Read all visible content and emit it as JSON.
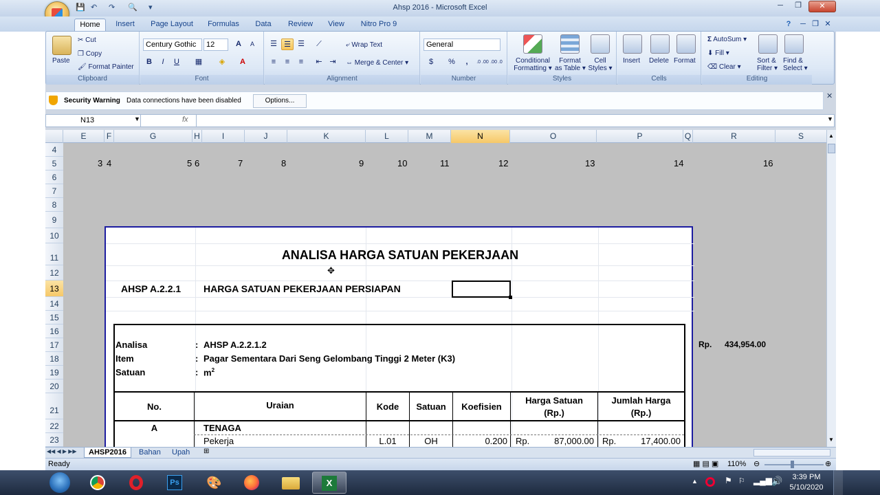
{
  "window": {
    "title": "Ahsp 2016 - Microsoft Excel",
    "minimize": "─",
    "restore": "❐",
    "close": "✕",
    "doc_min": "─",
    "doc_restore": "❐",
    "doc_close": "✕"
  },
  "qat": {
    "save": "💾",
    "undo": "↶",
    "redo": "↷",
    "preview": "🔍",
    "more": "▾"
  },
  "tabs": [
    "Home",
    "Insert",
    "Page Layout",
    "Formulas",
    "Data",
    "Review",
    "View",
    "Nitro Pro 9"
  ],
  "help_icon": "?",
  "ribbon": {
    "clipboard": {
      "label": "Clipboard",
      "paste": "Paste",
      "cut": "Cut",
      "copy": "Copy",
      "format_painter": "Format Painter"
    },
    "font": {
      "label": "Font",
      "name": "Century Gothic",
      "size": "12",
      "bold": "B",
      "italic": "I",
      "underline": "U",
      "grow": "A",
      "shrink": "A"
    },
    "alignment": {
      "label": "Alignment",
      "wrap": "Wrap Text",
      "merge": "Merge & Center"
    },
    "number": {
      "label": "Number",
      "format": "General",
      "currency": "$",
      "percent": "%",
      "comma": ",",
      "inc": ".0 .00",
      "dec": ".00 .0"
    },
    "styles": {
      "label": "Styles",
      "conditional": "Conditional",
      "conditional2": "Formatting",
      "format_table": "Format",
      "format_table2": "as Table",
      "cell_styles": "Cell",
      "cell_styles2": "Styles"
    },
    "cells": {
      "label": "Cells",
      "insert": "Insert",
      "delete": "Delete",
      "format": "Format"
    },
    "editing": {
      "label": "Editing",
      "autosum": "AutoSum",
      "fill": "Fill",
      "clear": "Clear",
      "sort": "Sort &",
      "sort2": "Filter",
      "find": "Find &",
      "find2": "Select"
    }
  },
  "security": {
    "label": "Security Warning",
    "message": "Data connections have been disabled",
    "options": "Options...",
    "close": "✕"
  },
  "formula_bar": {
    "name_box": "N13",
    "fx": "fx",
    "value": ""
  },
  "columns": [
    "E",
    "F",
    "G",
    "H",
    "I",
    "J",
    "K",
    "L",
    "M",
    "N",
    "O",
    "P",
    "Q",
    "R",
    "S"
  ],
  "rows": [
    "4",
    "5",
    "6",
    "7",
    "8",
    "9",
    "10",
    "11",
    "12",
    "13",
    "14",
    "15",
    "16",
    "17",
    "18",
    "19",
    "20",
    "21",
    "22",
    "23"
  ],
  "row5": [
    "3",
    "4",
    "5",
    "6",
    "7",
    "8",
    "9",
    "10",
    "11",
    "12",
    "13",
    "14",
    "16"
  ],
  "sheet": {
    "title": "ANALISA HARGA SATUAN PEKERJAAN",
    "code": "AHSP A.2.2.1",
    "heading": "HARGA SATUAN PEKERJAAN PERSIAPAN",
    "analisa_label": "Analisa",
    "analisa_value": "AHSP A.2.2.1.2",
    "item_label": "Item",
    "item_value": "Pagar Sementara Dari Seng Gelombang Tinggi 2 Meter (K3)",
    "satuan_label": "Satuan",
    "satuan_value": "m",
    "satuan_sup": "2",
    "colon": ":",
    "total_rp": "Rp.",
    "total_value": "434,954.00",
    "headers": {
      "no": "No.",
      "uraian": "Uraian",
      "kode": "Kode",
      "satuan": "Satuan",
      "koefisien": "Koefisien",
      "harga1": "Harga Satuan",
      "harga2": "(Rp.)",
      "jumlah1": "Jumlah Harga",
      "jumlah2": "(Rp.)"
    },
    "row22": {
      "no": "A",
      "uraian": "TENAGA"
    },
    "row23": {
      "uraian": "Pekerja",
      "kode": "L.01",
      "satuan": "OH",
      "koef": "0.200",
      "rp1": "Rp.",
      "harga": "87,000.00",
      "rp2": "Rp.",
      "jumlah": "17,400.00"
    }
  },
  "sheet_tabs": [
    "AHSP2016",
    "Bahan",
    "Upah"
  ],
  "status": {
    "ready": "Ready",
    "zoom": "110%"
  },
  "clock": {
    "time": "3:39 PM",
    "date": "5/10/2020"
  }
}
